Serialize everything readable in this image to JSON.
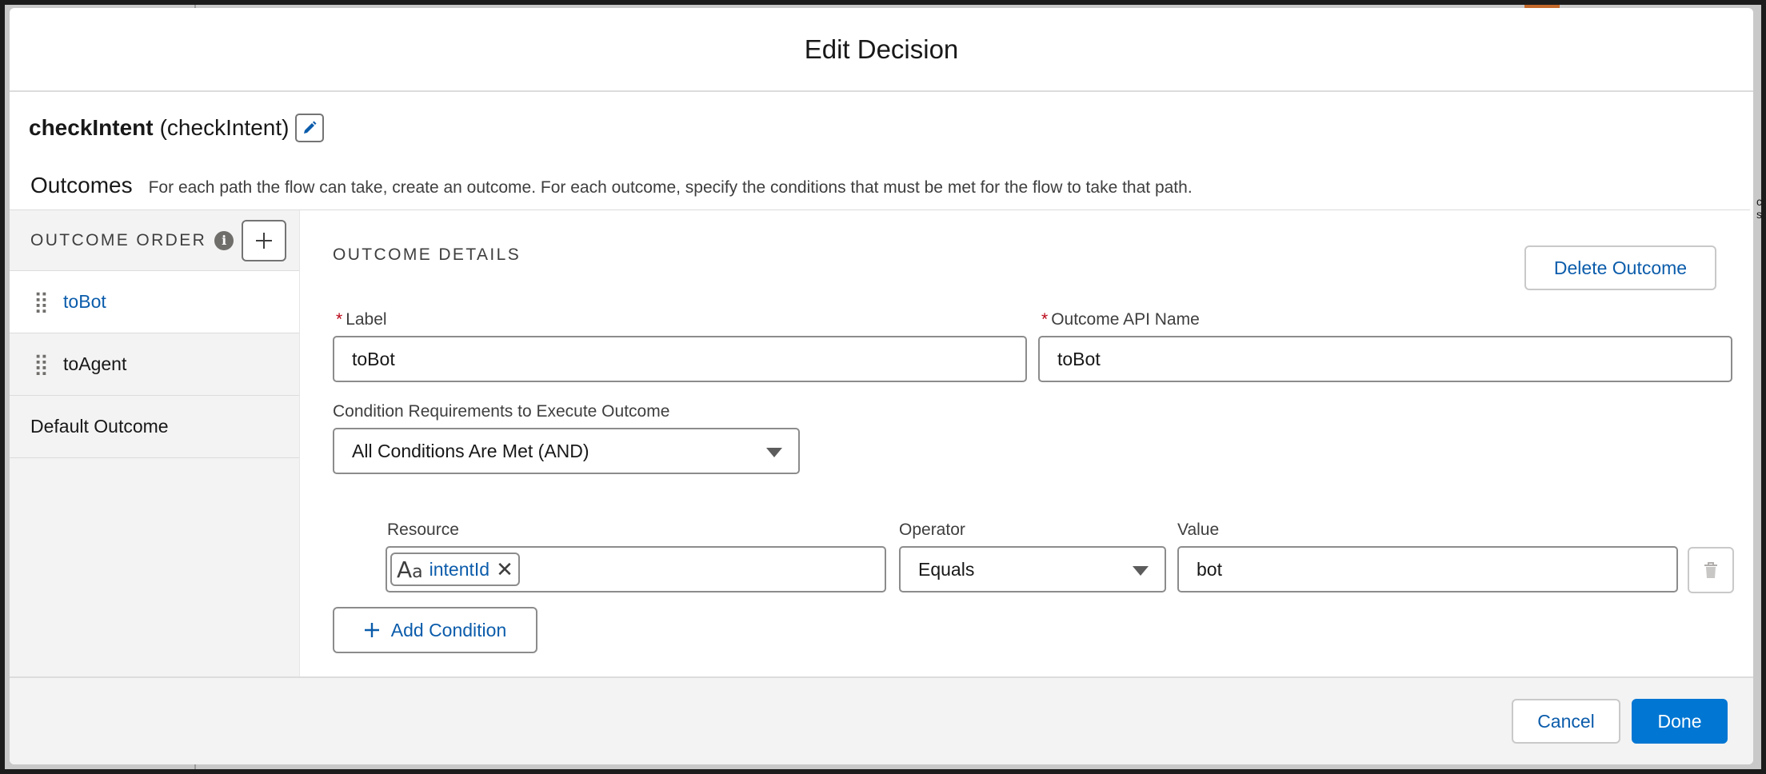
{
  "modal": {
    "title": "Edit Decision"
  },
  "element": {
    "label": "checkIntent",
    "api_name": "(checkIntent)",
    "edit_icon": "pencil-icon"
  },
  "outcomes_section": {
    "title": "Outcomes",
    "description": "For each path the flow can take, create an outcome. For each outcome, specify the conditions that must be met for the flow to take that path."
  },
  "outcome_order": {
    "header": "OUTCOME ORDER",
    "items": [
      {
        "label": "toBot",
        "active": true
      },
      {
        "label": "toAgent",
        "active": false
      }
    ],
    "default_label": "Default Outcome"
  },
  "outcome_details": {
    "header": "OUTCOME DETAILS",
    "delete_label": "Delete Outcome",
    "label_field": {
      "label": "Label",
      "value": "toBot"
    },
    "api_field": {
      "label": "Outcome API Name",
      "value": "toBot"
    },
    "condition_req": {
      "label": "Condition Requirements to Execute Outcome",
      "value": "All Conditions Are Met (AND)"
    },
    "condition": {
      "resource_label": "Resource",
      "resource_value": "intentId",
      "operator_label": "Operator",
      "operator_value": "Equals",
      "value_label": "Value",
      "value_value": "bot"
    },
    "add_condition_label": "Add Condition"
  },
  "footer": {
    "cancel_label": "Cancel",
    "done_label": "Done"
  },
  "colors": {
    "brand": "#0176d3",
    "link": "#0b5cab",
    "required": "#ba0517"
  }
}
